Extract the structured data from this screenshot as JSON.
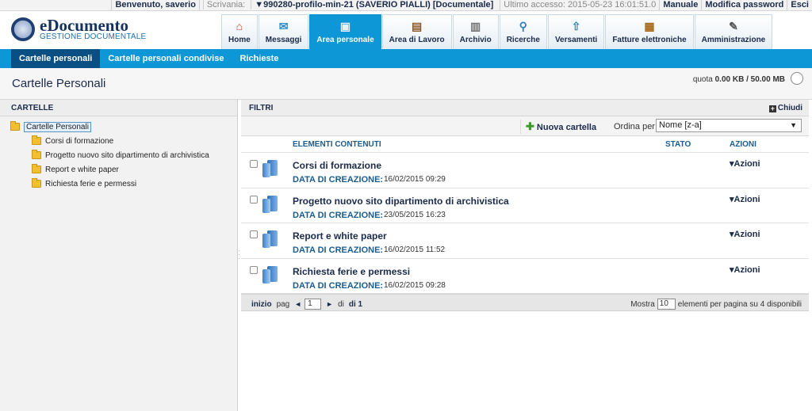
{
  "topbar": {
    "welcome": "Benvenuto, saverio",
    "scrivania_label": "Scrivania:",
    "scrivania_value": "▼990280-profilo-min-21 (SAVERIO PIALLI) [Documentale]",
    "last_access": "Ultimo accesso: 2015-05-23 16:01:51.0",
    "manuale": "Manuale",
    "modifica_password": "Modifica password",
    "esci": "Esci"
  },
  "logo": {
    "title": "eDocumento",
    "subtitle": "GESTIONE DOCUMENTALE"
  },
  "tabs": [
    {
      "label": "Home",
      "icon": "home-icon"
    },
    {
      "label": "Messaggi",
      "icon": "message-icon"
    },
    {
      "label": "Area personale",
      "icon": "personal-area-icon"
    },
    {
      "label": "Area di Lavoro",
      "icon": "work-area-icon"
    },
    {
      "label": "Archivio",
      "icon": "archive-icon"
    },
    {
      "label": "Ricerche",
      "icon": "search-icon"
    },
    {
      "label": "Versamenti",
      "icon": "deposit-icon"
    },
    {
      "label": "Fatture elettroniche",
      "icon": "invoice-icon"
    },
    {
      "label": "Amministrazione",
      "icon": "admin-tools-icon"
    }
  ],
  "subnav": [
    "Cartelle personali",
    "Cartelle personali condivise",
    "Richieste"
  ],
  "page": {
    "title": "Cartelle Personali",
    "quota_label": "quota",
    "quota_value": "0.00 KB / 50.00 MB"
  },
  "left": {
    "header": "CARTELLE",
    "root": "Cartelle Personali",
    "children": [
      "Corsi di formazione",
      "Progetto nuovo sito dipartimento di archivistica",
      "Report e white paper",
      "Richiesta ferie e permessi"
    ]
  },
  "right": {
    "filters": "FILTRI",
    "close": "Chiudi",
    "new_folder": "Nuova cartella",
    "order_label": "Ordina per",
    "order_value": "Nome [z-a]",
    "columns": {
      "elements": "ELEMENTI CONTENUTI",
      "status": "STATO",
      "actions": "AZIONI"
    },
    "date_label": "DATA DI CREAZIONE:",
    "actions_label": "▾Azioni",
    "rows": [
      {
        "title": "Corsi di formazione",
        "date": "16/02/2015 09:29"
      },
      {
        "title": "Progetto nuovo sito dipartimento di archivistica",
        "date": "23/05/2015 16:23"
      },
      {
        "title": "Report e white paper",
        "date": "16/02/2015 11:52"
      },
      {
        "title": "Richiesta ferie e permessi",
        "date": "16/02/2015 09:28"
      }
    ]
  },
  "pager": {
    "start": "inizio",
    "pag": "pag",
    "prev": "◄",
    "current": "1",
    "next": "►",
    "of": "di",
    "total": "di 1",
    "show_label": "Mostra",
    "per_page": "10",
    "suffix": "elementi per pagina su 4 disponibili"
  },
  "colors": {
    "accent": "#0d97d6",
    "subnav_active": "#0a4f84",
    "brand_dark": "#14325f"
  }
}
